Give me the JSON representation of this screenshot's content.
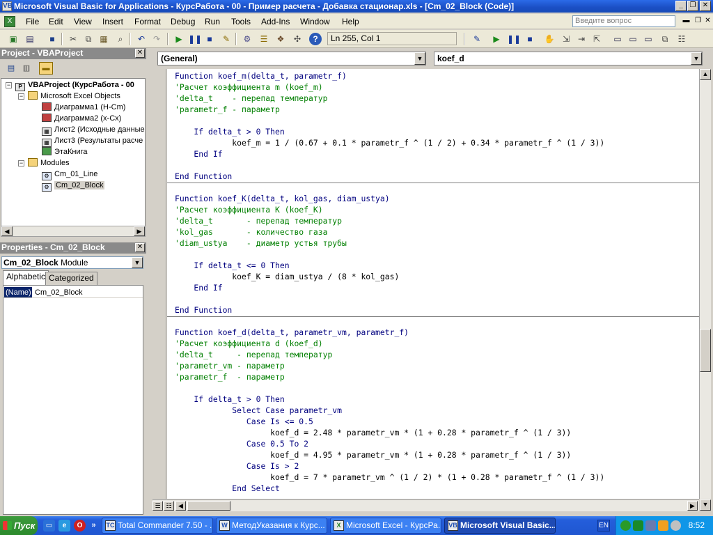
{
  "window": {
    "title": "Microsoft Visual Basic for Applications - КурсРабота - 00 - Пример расчета - Добавка стационар.xls - [Cm_02_Block (Code)]"
  },
  "menu": {
    "items": [
      "File",
      "Edit",
      "View",
      "Insert",
      "Format",
      "Debug",
      "Run",
      "Tools",
      "Add-Ins",
      "Window",
      "Help"
    ],
    "ask_placeholder": "Введите вопрос"
  },
  "toolbar": {
    "status": "Ln 255, Col 1"
  },
  "project": {
    "title": "Project - VBAProject",
    "tree": [
      {
        "label": "VBAProject (КурсРабота - 00",
        "bold": true
      },
      {
        "label": "Microsoft Excel Objects"
      },
      {
        "label": "Диаграмма1 (H-Cm)"
      },
      {
        "label": "Диаграмма2 (x-Cx)"
      },
      {
        "label": "Лист2 (Исходные данные"
      },
      {
        "label": "Лист3 (Результаты расче"
      },
      {
        "label": "ЭтаКнига"
      },
      {
        "label": "Modules"
      },
      {
        "label": "Cm_01_Line"
      },
      {
        "label": "Cm_02_Block",
        "selected": true
      }
    ]
  },
  "properties": {
    "title": "Properties - Cm_02_Block",
    "object_name": "Cm_02_Block",
    "object_type": "Module",
    "tabs": [
      "Alphabetic",
      "Categorized"
    ],
    "row": {
      "name": "(Name)",
      "value": "Cm_02_Block"
    }
  },
  "code": {
    "object_combo": "(General)",
    "proc_combo": "koef_d",
    "lines": [
      {
        "t": "Function koef_m(delta_t, parametr_f)",
        "c": "kw"
      },
      {
        "t": "'Расчет коэффициента m (koef_m)",
        "c": "cm"
      },
      {
        "t": "'delta_t    - перепад температур",
        "c": "cm"
      },
      {
        "t": "'parametr_f - параметр",
        "c": "cm"
      },
      {
        "t": "",
        "c": ""
      },
      {
        "t": "    If delta_t > 0 Then",
        "c": "kw"
      },
      {
        "t": "            koef_m = 1 / (0.67 + 0.1 * parametr_f ^ (1 / 2) + 0.34 * parametr_f ^ (1 / 3))",
        "c": ""
      },
      {
        "t": "    End If",
        "c": "kw"
      },
      {
        "t": "",
        "c": ""
      },
      {
        "t": "End Function",
        "c": "kw"
      },
      {
        "t": "SEP",
        "c": "sep"
      },
      {
        "t": "Function koef_K(delta_t, kol_gas, diam_ustya)",
        "c": "kw"
      },
      {
        "t": "'Расчет коэффициента K (koef_K)",
        "c": "cm"
      },
      {
        "t": "'delta_t       - перепад температур",
        "c": "cm"
      },
      {
        "t": "'kol_gas       - количество газа",
        "c": "cm"
      },
      {
        "t": "'diam_ustya    - диаметр устья трубы",
        "c": "cm"
      },
      {
        "t": "",
        "c": ""
      },
      {
        "t": "    If delta_t <= 0 Then",
        "c": "kw"
      },
      {
        "t": "            koef_K = diam_ustya / (8 * kol_gas)",
        "c": ""
      },
      {
        "t": "    End If",
        "c": "kw"
      },
      {
        "t": "",
        "c": ""
      },
      {
        "t": "End Function",
        "c": "kw"
      },
      {
        "t": "SEP",
        "c": "sep"
      },
      {
        "t": "Function koef_d(delta_t, parametr_vm, parametr_f)",
        "c": "kw"
      },
      {
        "t": "'Расчет коэффициента d (koef_d)",
        "c": "cm"
      },
      {
        "t": "'delta_t     - перепад температур",
        "c": "cm"
      },
      {
        "t": "'parametr_vm - параметр",
        "c": "cm"
      },
      {
        "t": "'parametr_f  - параметр",
        "c": "cm"
      },
      {
        "t": "",
        "c": ""
      },
      {
        "t": "    If delta_t > 0 Then",
        "c": "kw"
      },
      {
        "t": "            Select Case parametr_vm",
        "c": "kw"
      },
      {
        "t": "               Case Is <= 0.5",
        "c": "kw"
      },
      {
        "t": "                    koef_d = 2.48 * parametr_vm * (1 + 0.28 * parametr_f ^ (1 / 3))",
        "c": ""
      },
      {
        "t": "               Case 0.5 To 2",
        "c": "kw"
      },
      {
        "t": "                    koef_d = 4.95 * parametr_vm * (1 + 0.28 * parametr_f ^ (1 / 3))",
        "c": ""
      },
      {
        "t": "               Case Is > 2",
        "c": "kw"
      },
      {
        "t": "                    koef_d = 7 * parametr_vm ^ (1 / 2) * (1 + 0.28 * parametr_f ^ (1 / 3))",
        "c": ""
      },
      {
        "t": "            End Select",
        "c": "kw"
      }
    ]
  },
  "taskbar": {
    "start_label": "Пуск",
    "tasks": [
      {
        "label": "Total Commander 7.50 - ...",
        "icon": "TC"
      },
      {
        "label": "МетодУказания к Курс...",
        "icon": "W"
      },
      {
        "label": "Microsoft Excel - КурсРа...",
        "icon": "X"
      },
      {
        "label": "Microsoft Visual Basic...",
        "icon": "VB",
        "active": true
      }
    ],
    "lang": "EN",
    "clock": "8:52"
  }
}
